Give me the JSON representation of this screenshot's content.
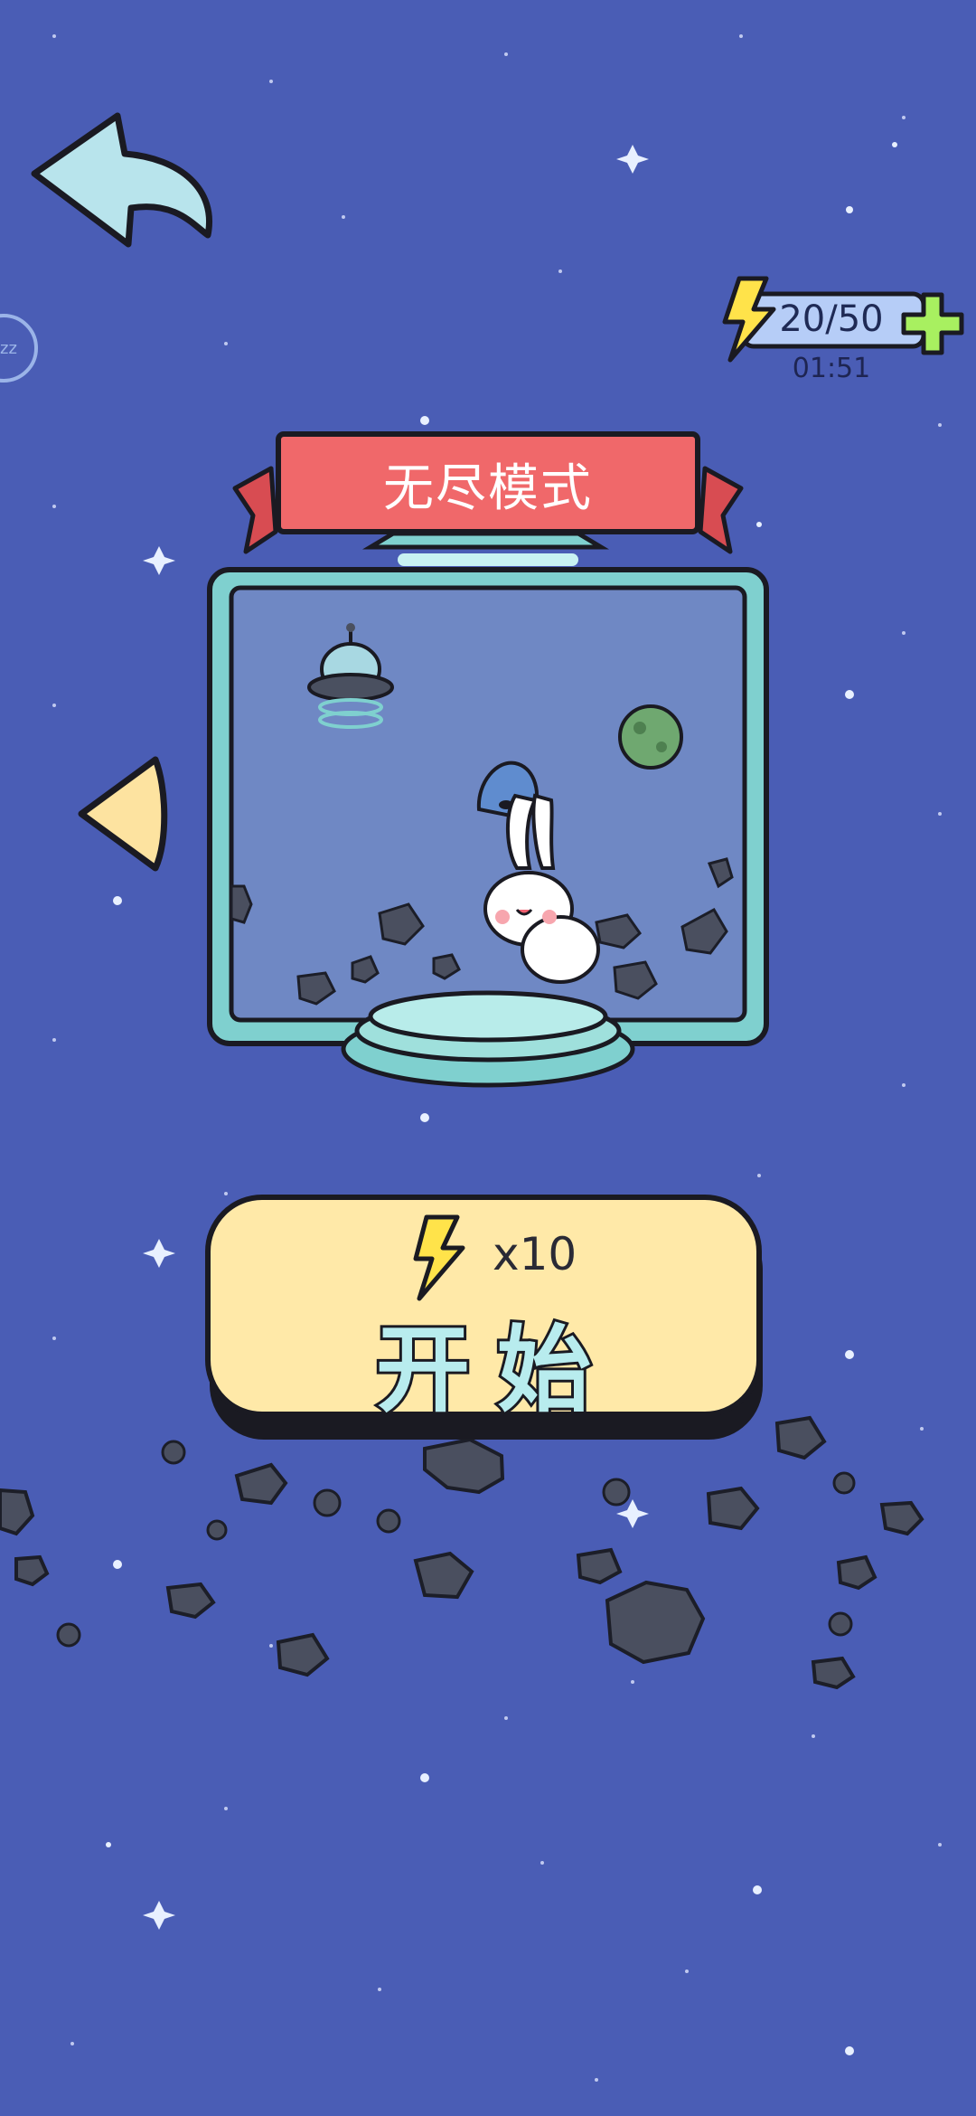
{
  "energy": {
    "value": "20/50",
    "timer": "01:51",
    "add_icon": "plus-icon",
    "lightning_icon": "lightning-icon"
  },
  "mode": {
    "title": "无尽模式"
  },
  "start_button": {
    "cost": "x10",
    "label": "开始",
    "cost_icon": "lightning-icon"
  },
  "navigation": {
    "back_icon": "back-arrow-icon",
    "prev_mode_icon": "left-triangle-icon"
  },
  "colors": {
    "background": "#4a5db5",
    "banner": "#f0686a",
    "frame": "#7fd0cf",
    "button": "#ffe9a8",
    "triangle": "#fde3a0",
    "back_arrow": "#b8e4ec",
    "energy_bar": "#b6cdf7",
    "plus": "#a8f060"
  }
}
